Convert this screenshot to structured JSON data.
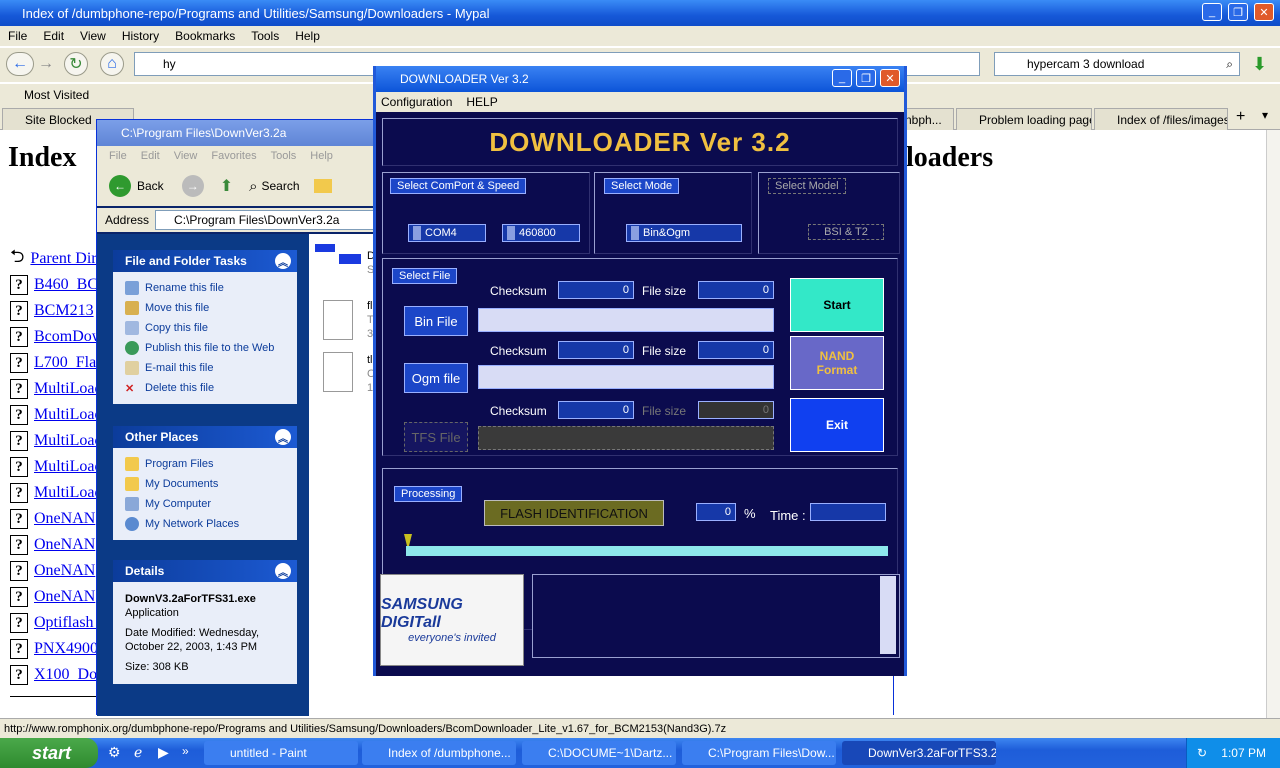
{
  "browser": {
    "title": "Index of /dumbphone-repo/Programs and Utilities/Samsung/Downloaders - Mypal",
    "menu": [
      "File",
      "Edit",
      "View",
      "History",
      "Bookmarks",
      "Tools",
      "Help"
    ],
    "url": "hy",
    "search": "hypercam 3 download",
    "bookmarks": {
      "most_visited": "Most Visited"
    },
    "tabs": [
      {
        "label": "Site Blocked"
      },
      {
        "label": "nbph..."
      },
      {
        "label": "Problem loading page"
      },
      {
        "label": "Index of /files/images/"
      }
    ],
    "page": {
      "heading_left": "Index",
      "heading_right": "loaders",
      "parent": "Parent Dir",
      "entries": [
        "B460_BC",
        "BCM213",
        "BcomDow",
        "L700_Flas",
        "MultiLoac",
        "MultiLoac",
        "MultiLoac",
        "MultiLoac",
        "MultiLoac",
        "OneNAN",
        "OneNAN",
        "OneNAN",
        "OneNAN",
        "Optiflash_",
        "PNX4900",
        "X100_Do"
      ]
    },
    "status": "http://www.romphonix.org/dumbphone-repo/Programs and Utilities/Samsung/Downloaders/BcomDownloader_Lite_v1.67_for_BCM2153(Nand3G).7z"
  },
  "explorer": {
    "title": "C:\\Program Files\\DownVer3.2a",
    "menu": [
      "File",
      "Edit",
      "View",
      "Favorites",
      "Tools",
      "Help"
    ],
    "back": "Back",
    "search": "Search",
    "address_label": "Address",
    "address": "C:\\Program Files\\DownVer3.2a",
    "file_tasks": {
      "header": "File and Folder Tasks",
      "items": [
        "Rename this file",
        "Move this file",
        "Copy this file",
        "Publish this file to the Web",
        "E-mail this file",
        "Delete this file"
      ]
    },
    "other_places": {
      "header": "Other Places",
      "items": [
        "Program Files",
        "My Documents",
        "My Computer",
        "My Network Places"
      ]
    },
    "details": {
      "header": "Details",
      "name": "DownV3.2aForTFS31.exe",
      "type": "Application",
      "modified": "Date Modified: Wednesday, October 22, 2003, 1:43 PM",
      "size": "Size: 308 KB"
    },
    "files": [
      "D",
      "S",
      "fl",
      "T",
      "3",
      "tl",
      "C",
      "1"
    ]
  },
  "downloader": {
    "title": "DOWNLOADER Ver 3.2",
    "menu": [
      "Configuration",
      "HELP"
    ],
    "banner": "DOWNLOADER Ver 3.2",
    "comport_label": "Select ComPort & Speed",
    "comport": "COM4",
    "speed": "460800",
    "mode_label": "Select Mode",
    "mode": "Bin&Ogm",
    "model_label": "Select Model",
    "model": "BSI & T2",
    "select_file_label": "Select File",
    "checksum_label": "Checksum",
    "filesize_label": "File size",
    "bin_btn": "Bin File",
    "bin_checksum": "0",
    "bin_size": "0",
    "ogm_btn": "Ogm file",
    "ogm_checksum": "0",
    "ogm_size": "0",
    "tfs_btn": "TFS File",
    "tfs_checksum": "0",
    "tfs_size": "0",
    "start_btn": "Start",
    "nand_btn_line1": "NAND",
    "nand_btn_line2": "Format",
    "exit_btn": "Exit",
    "processing_label": "Processing",
    "flash_status": "FLASH IDENTIFICATION",
    "percent": "0",
    "percent_sign": "%",
    "time_label": "Time :",
    "time_value": "",
    "progress": 0,
    "logo_line1": "SAMSUNG DIGITall",
    "logo_line2": "everyone's invited"
  },
  "taskbar": {
    "start": "start",
    "tasks": [
      "untitled - Paint",
      "Index of /dumbphone...",
      "C:\\DOCUME~1\\Dartz...",
      "C:\\Program Files\\Dow...",
      "DownVer3.2aForTFS3.2"
    ],
    "time": "1:07 PM"
  },
  "colors": {
    "downloader_bg": "#0b0b4e",
    "banner_text": "#f0c040",
    "start_btn": "#33e8c8",
    "nand_btn": "#6868c8",
    "exit_btn": "#1040f0",
    "xp_blue": "#0c54d8"
  }
}
